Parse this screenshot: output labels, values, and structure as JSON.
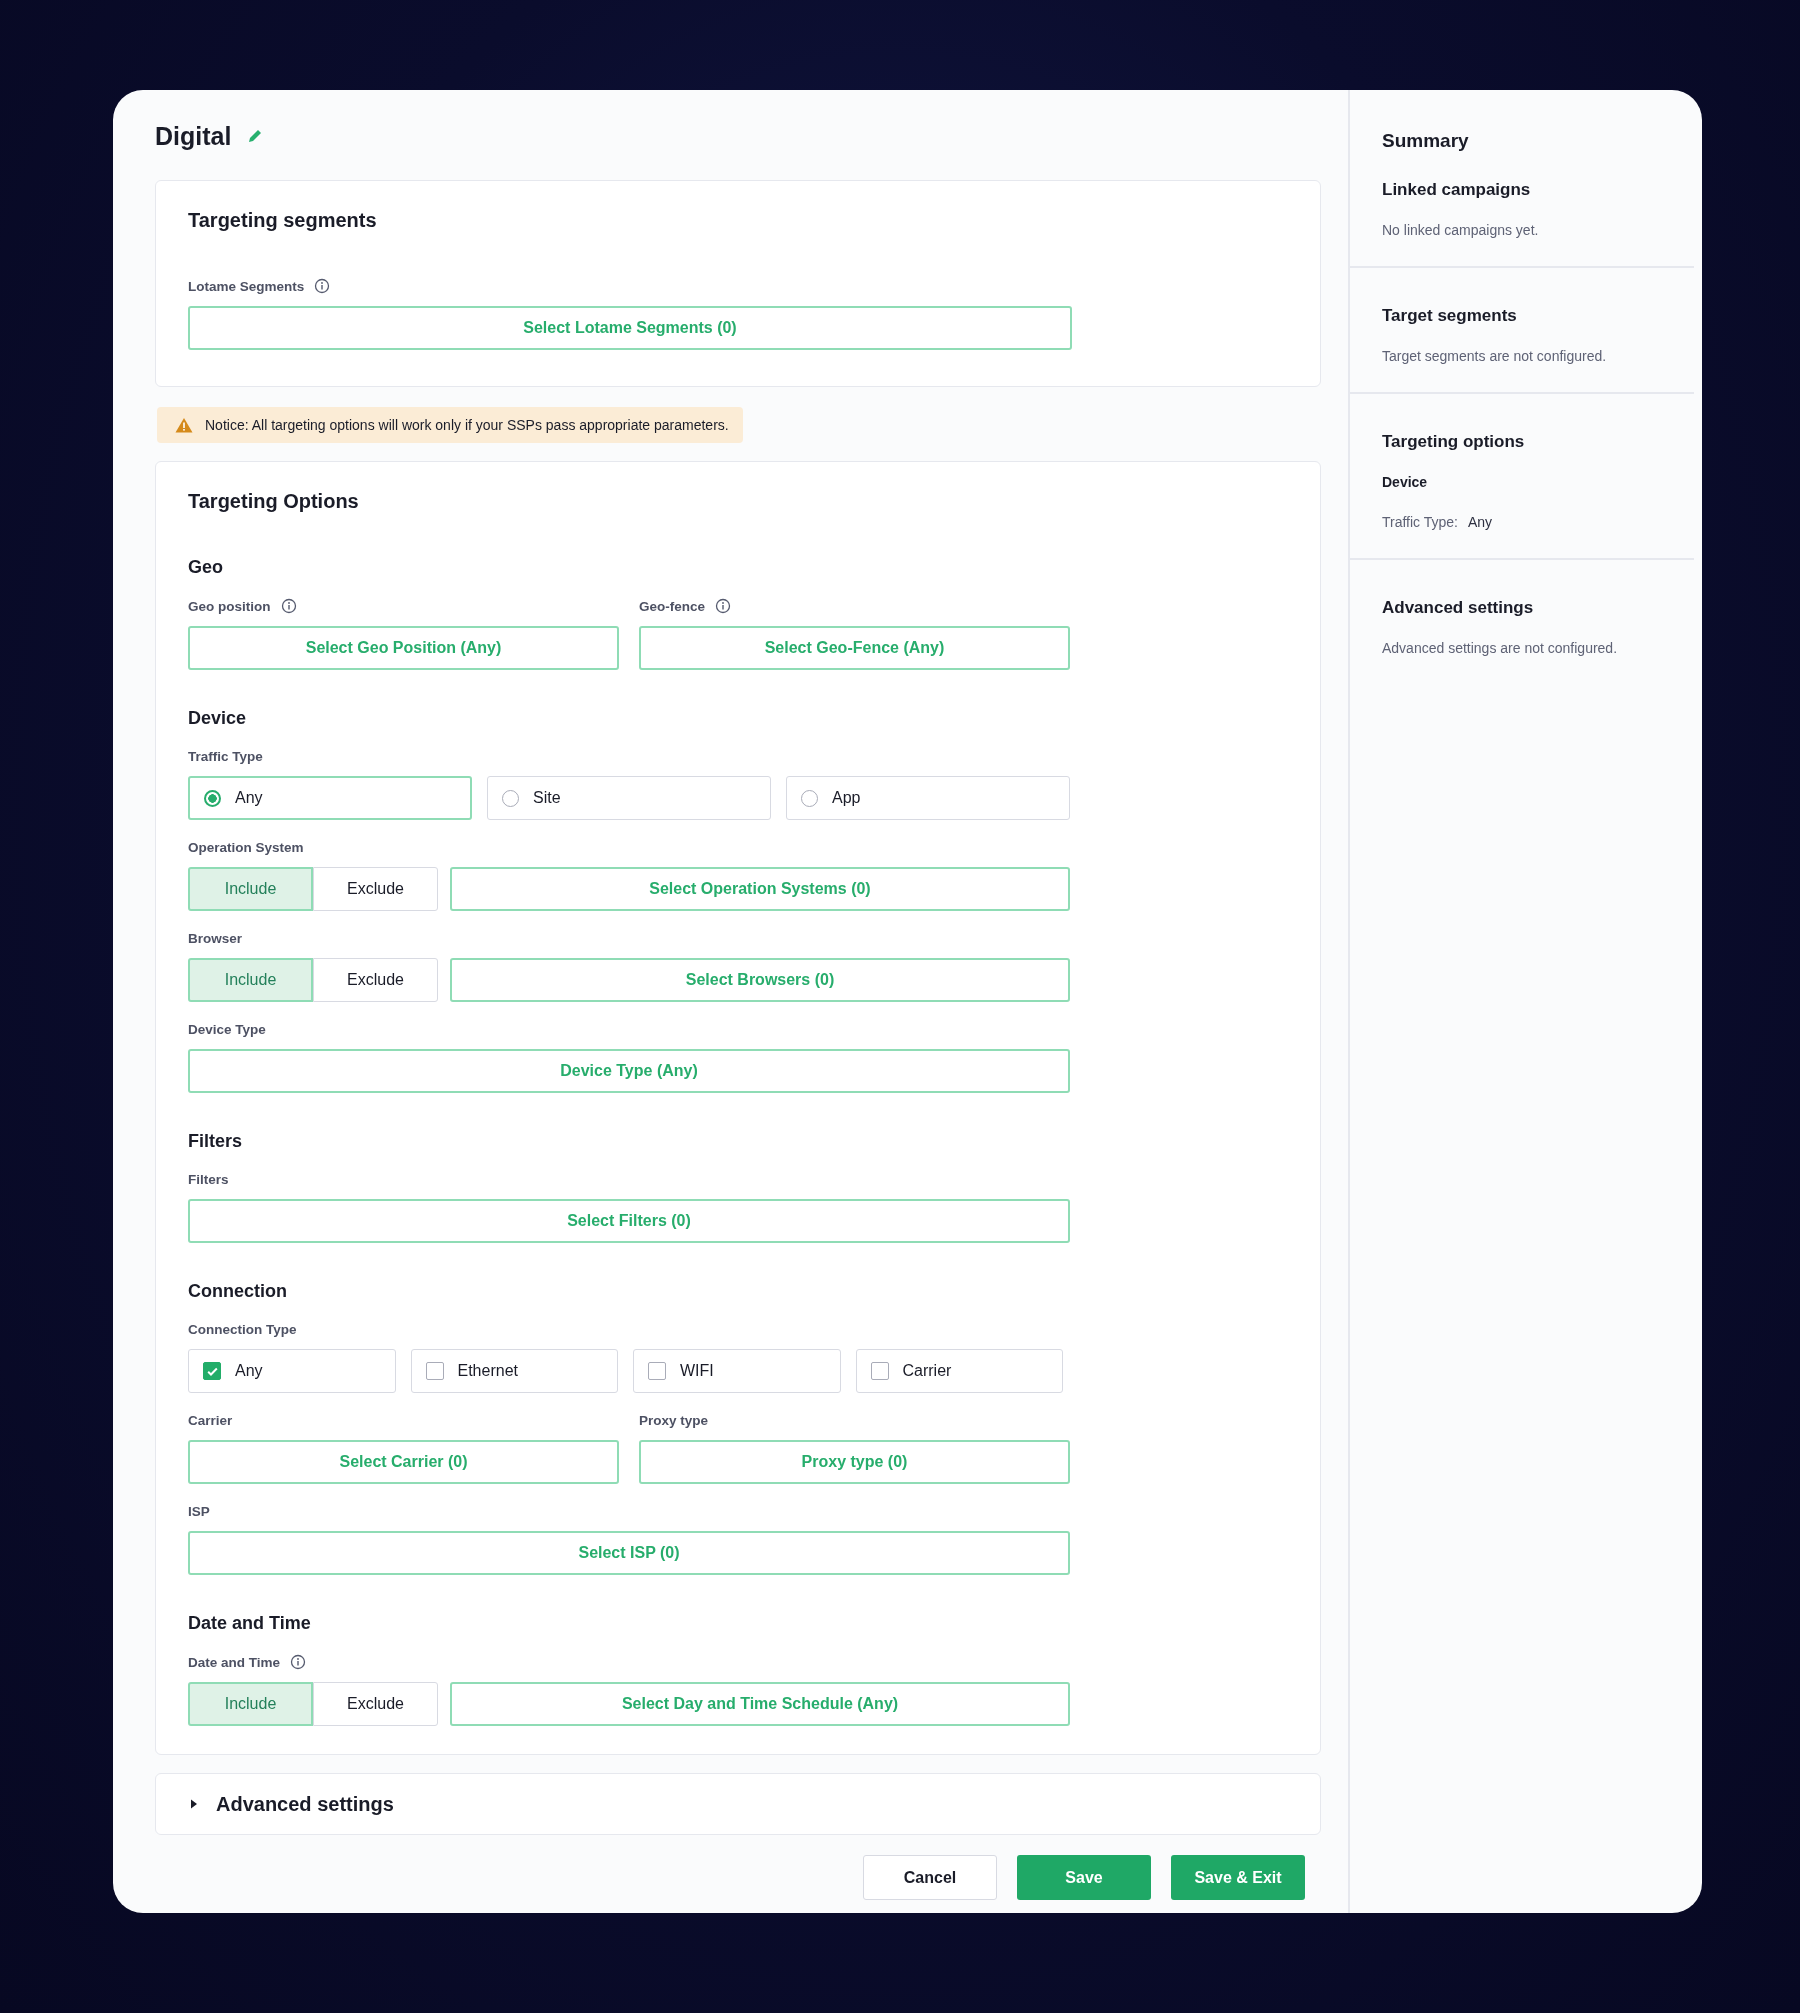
{
  "title": "Digital",
  "segments": {
    "title": "Targeting segments",
    "fields": [
      {
        "label": "Lotame Segments",
        "info": true,
        "button": "Select Lotame Segments (0)"
      }
    ]
  },
  "notice": "Notice: All targeting options will work only if your SSPs pass appropriate parameters.",
  "options": {
    "title": "Targeting Options",
    "groups": [
      {
        "heading": "Geo",
        "rows": [
          [
            {
              "kind": "select",
              "label": "Geo position",
              "info": true,
              "button": "Select Geo Position (Any)"
            },
            {
              "kind": "select",
              "label": "Geo-fence",
              "info": true,
              "button": "Select Geo-Fence (Any)"
            }
          ]
        ]
      },
      {
        "heading": "Device",
        "rows": [
          [
            {
              "kind": "radio",
              "label": "Traffic Type",
              "info": false,
              "options": [
                {
                  "label": "Any",
                  "selected": true
                },
                {
                  "label": "Site",
                  "selected": false
                },
                {
                  "label": "App",
                  "selected": false
                }
              ]
            }
          ],
          [
            {
              "kind": "include_select",
              "label": "Operation System",
              "info": false,
              "options": [
                {
                  "label": "Include",
                  "selected": true
                },
                {
                  "label": "Exclude",
                  "selected": false
                }
              ],
              "button": "Select Operation Systems (0)"
            }
          ],
          [
            {
              "kind": "include_select",
              "label": "Browser",
              "info": false,
              "options": [
                {
                  "label": "Include",
                  "selected": true
                },
                {
                  "label": "Exclude",
                  "selected": false
                }
              ],
              "button": "Select Browsers (0)"
            }
          ],
          [
            {
              "kind": "select",
              "label": "Device Type",
              "info": false,
              "button": "Device Type (Any)"
            }
          ]
        ]
      },
      {
        "heading": "Filters",
        "rows": [
          [
            {
              "kind": "select",
              "label": "Filters",
              "info": false,
              "button": "Select Filters (0)"
            }
          ]
        ]
      },
      {
        "heading": "Connection",
        "rows": [
          [
            {
              "kind": "checkbox",
              "label": "Connection Type",
              "info": false,
              "options": [
                {
                  "label": "Any",
                  "checked": true
                },
                {
                  "label": "Ethernet",
                  "checked": false
                },
                {
                  "label": "WIFI",
                  "checked": false
                },
                {
                  "label": "Carrier",
                  "checked": false
                }
              ]
            }
          ],
          [
            {
              "kind": "select",
              "label": "Carrier",
              "info": false,
              "button": "Select Carrier (0)"
            },
            {
              "kind": "select",
              "label": "Proxy type",
              "info": false,
              "button": "Proxy type (0)"
            }
          ],
          [
            {
              "kind": "select",
              "label": "ISP",
              "info": false,
              "button": "Select ISP (0)"
            }
          ]
        ]
      },
      {
        "heading": "Date and Time",
        "rows": [
          [
            {
              "kind": "include_select",
              "label": "Date and Time",
              "info": true,
              "options": [
                {
                  "label": "Include",
                  "selected": true
                },
                {
                  "label": "Exclude",
                  "selected": false
                }
              ],
              "button": "Select Day and Time Schedule (Any)"
            }
          ]
        ]
      }
    ]
  },
  "advanced": {
    "label": "Advanced settings",
    "expanded": false
  },
  "buttons": [
    {
      "label": "Cancel",
      "kind": "secondary"
    },
    {
      "label": "Save",
      "kind": "primary"
    },
    {
      "label": "Save & Exit",
      "kind": "primary"
    }
  ],
  "summary": {
    "title": "Summary",
    "sections": [
      {
        "heading": "Linked campaigns",
        "items": [
          {
            "kind": "text",
            "text": "No linked campaigns yet."
          }
        ]
      },
      {
        "heading": "Target segments",
        "items": [
          {
            "kind": "text",
            "text": "Target segments are not configured."
          }
        ]
      },
      {
        "heading": "Targeting options",
        "items": [
          {
            "kind": "subheading",
            "text": "Device"
          },
          {
            "kind": "pair",
            "label": "Traffic Type:",
            "value": "Any"
          }
        ]
      },
      {
        "heading": "Advanced settings",
        "items": [
          {
            "kind": "text",
            "text": "Advanced settings are not configured."
          }
        ]
      }
    ]
  }
}
